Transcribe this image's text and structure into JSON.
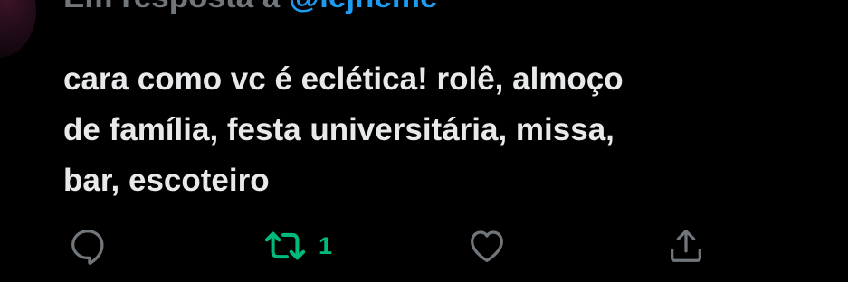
{
  "reply": {
    "prefix": "Em resposta a",
    "handle": "@lejneme"
  },
  "tweet": {
    "text": "cara como vc é eclética! rolê, almoço\nde família, festa universitária, missa,\nbar, escoteiro"
  },
  "actions": {
    "reply": {
      "icon": "reply-icon"
    },
    "retweet": {
      "icon": "retweet-icon",
      "count": "1",
      "active": true,
      "color": "#00ba7c"
    },
    "like": {
      "icon": "heart-icon"
    },
    "share": {
      "icon": "share-icon"
    }
  },
  "colors": {
    "background": "#000000",
    "text": "#e7e9ea",
    "muted": "#71767b",
    "link": "#1d9bf0",
    "retweet": "#00ba7c",
    "icon": "#71767b"
  }
}
